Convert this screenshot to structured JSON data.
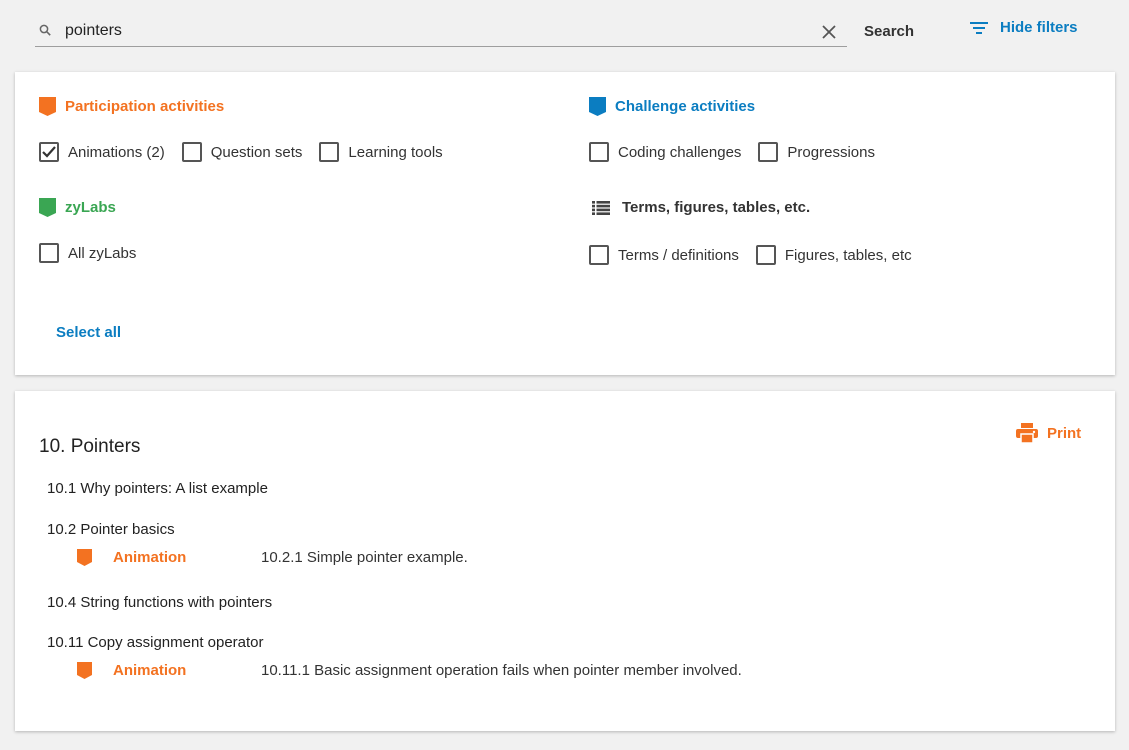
{
  "search": {
    "value": "pointers",
    "button_label": "Search"
  },
  "hide_filters_label": "Hide filters",
  "filters": {
    "participation": {
      "title": "Participation activities",
      "options": [
        {
          "label": "Animations (2)",
          "checked": true
        },
        {
          "label": "Question sets",
          "checked": false
        },
        {
          "label": "Learning tools",
          "checked": false
        }
      ]
    },
    "challenge": {
      "title": "Challenge activities",
      "options": [
        {
          "label": "Coding challenges",
          "checked": false
        },
        {
          "label": "Progressions",
          "checked": false
        }
      ]
    },
    "zylabs": {
      "title": "zyLabs",
      "options": [
        {
          "label": "All zyLabs",
          "checked": false
        }
      ]
    },
    "terms": {
      "title": "Terms, figures, tables, etc.",
      "options": [
        {
          "label": "Terms / definitions",
          "checked": false
        },
        {
          "label": "Figures, tables, etc",
          "checked": false
        }
      ]
    },
    "select_all_label": "Select all"
  },
  "colors": {
    "orange": "#f37221",
    "blue": "#0b7dc1",
    "green": "#3aa653"
  },
  "results": {
    "chapter_title": "10. Pointers",
    "print_label": "Print",
    "sections": [
      {
        "title": "10.1 Why pointers: A list example"
      },
      {
        "title": "10.2 Pointer basics",
        "activity": {
          "type": "Animation",
          "desc": "10.2.1 Simple pointer example."
        }
      },
      {
        "title": "10.4 String functions with pointers"
      },
      {
        "title": "10.11 Copy assignment operator",
        "activity": {
          "type": "Animation",
          "desc": "10.11.1 Basic assignment operation fails when pointer member involved."
        }
      }
    ]
  }
}
